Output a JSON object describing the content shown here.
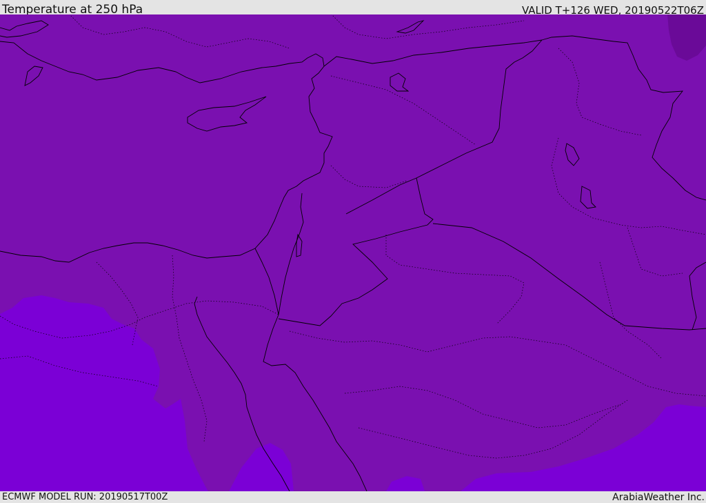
{
  "header": {
    "title": "Temperature at 250 hPa",
    "valid": "VALID T+126 WED, 20190522T06Z"
  },
  "footer": {
    "model_run": "ECMWF MODEL RUN: 20190517T00Z",
    "credit": "ArabiaWeather Inc."
  },
  "map": {
    "base_fill_color": "#7a10b0",
    "warm_fill_color": "#7b00d6",
    "cold_fill_color": "#6a0a98",
    "boundary_color": "#000000"
  }
}
